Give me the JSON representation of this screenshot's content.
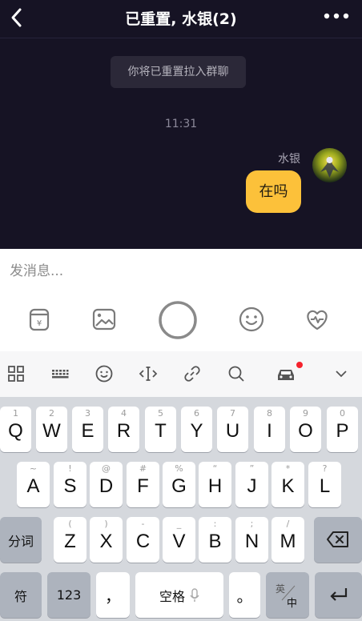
{
  "header": {
    "title": "已重置, 水银(2)",
    "back_icon": "chevron-left-icon",
    "more_icon": "more-dots-icon"
  },
  "chat": {
    "system_message": "你将已重置拉入群聊",
    "timestamp": "11:31",
    "sender": "水银",
    "message": "在吗",
    "bubble_color": "#fcc13a"
  },
  "input": {
    "placeholder": "发消息..."
  },
  "tools": [
    "cup-icon",
    "image-icon",
    "record-button-icon",
    "emoji-icon",
    "heart-icon"
  ],
  "keyboard_toolbar": [
    "grid-icon",
    "keyboard-icon",
    "smiley-icon",
    "cursor-icon",
    "link-icon",
    "search-icon",
    "car-icon",
    "collapse-icon"
  ],
  "keyboard": {
    "row1": [
      {
        "hint": "1",
        "key": "Q"
      },
      {
        "hint": "2",
        "key": "W"
      },
      {
        "hint": "3",
        "key": "E"
      },
      {
        "hint": "4",
        "key": "R"
      },
      {
        "hint": "5",
        "key": "T"
      },
      {
        "hint": "6",
        "key": "Y"
      },
      {
        "hint": "7",
        "key": "U"
      },
      {
        "hint": "8",
        "key": "I"
      },
      {
        "hint": "9",
        "key": "O"
      },
      {
        "hint": "0",
        "key": "P"
      }
    ],
    "row2": [
      {
        "hint": "~",
        "key": "A"
      },
      {
        "hint": "!",
        "key": "S"
      },
      {
        "hint": "@",
        "key": "D"
      },
      {
        "hint": "#",
        "key": "F"
      },
      {
        "hint": "%",
        "key": "G"
      },
      {
        "hint": "“",
        "key": "H"
      },
      {
        "hint": "”",
        "key": "J"
      },
      {
        "hint": "*",
        "key": "K"
      },
      {
        "hint": "?",
        "key": "L"
      }
    ],
    "row3": [
      {
        "hint": "(",
        "key": "Z"
      },
      {
        "hint": ")",
        "key": "X"
      },
      {
        "hint": "-",
        "key": "C"
      },
      {
        "hint": "_",
        "key": "V"
      },
      {
        "hint": ":",
        "key": "B"
      },
      {
        "hint": ";",
        "key": "N"
      },
      {
        "hint": "/",
        "key": "M"
      }
    ],
    "fenci": "分词",
    "fu": "符",
    "num": "123",
    "comma": "，",
    "space": "空格",
    "period": "。",
    "lang_top": "英",
    "lang_bottom": "中"
  }
}
